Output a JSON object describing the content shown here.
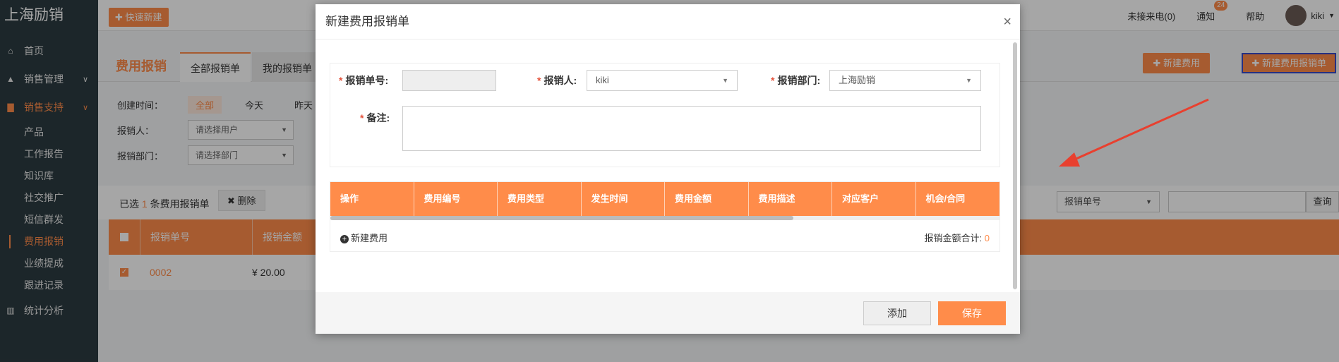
{
  "sidebar": {
    "logo": "上海励销",
    "items": [
      {
        "label": "首页",
        "icon": "home-icon"
      },
      {
        "label": "销售管理",
        "icon": "chart-icon"
      },
      {
        "label": "销售支持",
        "icon": "file-icon"
      }
    ],
    "sub_items": [
      "产品",
      "工作报告",
      "知识库",
      "社交推广",
      "短信群发",
      "费用报销",
      "业绩提成",
      "跟进记录"
    ],
    "last_item": {
      "label": "统计分析",
      "icon": "bar-chart-icon"
    }
  },
  "topbar": {
    "quick_new": "快速新建",
    "missed_calls": "未接来电(0)",
    "notify": "通知",
    "notify_count": "24",
    "help": "帮助",
    "user": "kiki"
  },
  "page": {
    "title": "费用报销",
    "tabs": [
      "全部报销单",
      "我的报销单"
    ],
    "new_fee_btn": "新建费用",
    "new_expense_btn": "新建费用报销单",
    "filter_created_label": "创建时间：",
    "filter_chips": [
      "全部",
      "今天",
      "昨天"
    ],
    "filter_person_label": "报销人：",
    "filter_person_placeholder": "请选择用户",
    "filter_dept_label": "报销部门：",
    "filter_dept_placeholder": "请选择部门",
    "selected_prefix": "已选",
    "selected_count": "1",
    "selected_suffix": "条费用报销单",
    "delete_btn": "删除",
    "search_field": "报销单号",
    "search_btn": "查询",
    "columns": [
      "报销单号",
      "报销金额"
    ],
    "row": {
      "no": "0002",
      "amount": "¥ 20.00"
    }
  },
  "modal": {
    "title": "新建费用报销单",
    "close": "×",
    "no_label": "报销单号:",
    "person_label": "报销人:",
    "person_value": "kiki",
    "dept_label": "报销部门:",
    "dept_value": "上海励销",
    "note_label": "备注:",
    "grid_columns": [
      "操作",
      "费用编号",
      "费用类型",
      "发生时间",
      "费用金额",
      "费用描述",
      "对应客户",
      "机会/合同"
    ],
    "add_fee": "新建费用",
    "total_label": "报销金额合计:",
    "total_value": "0",
    "btn_add": "添加",
    "btn_save": "保存"
  },
  "colors": {
    "accent": "#ff8c4a",
    "sidebar": "#2c3b41",
    "highlight_border": "#3a4bc9",
    "arrow": "#e8402f"
  }
}
